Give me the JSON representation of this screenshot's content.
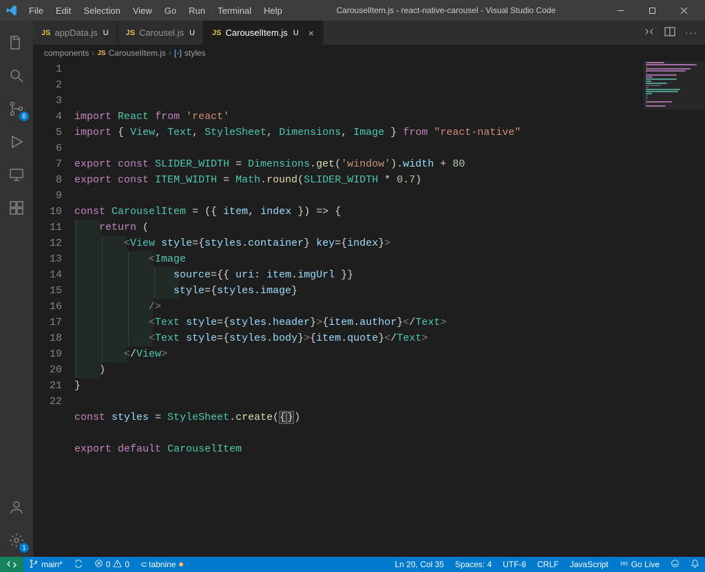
{
  "window": {
    "title": "CarouselItem.js - react-native-carousel - Visual Studio Code"
  },
  "menubar": [
    "File",
    "Edit",
    "Selection",
    "View",
    "Go",
    "Run",
    "Terminal",
    "Help"
  ],
  "activitybar": {
    "explorer_badge": "",
    "scm_badge": "6",
    "settings_badge": "1"
  },
  "tabs": [
    {
      "label": "appData.js",
      "modified": "U",
      "active": false
    },
    {
      "label": "Carousel.js",
      "modified": "U",
      "active": false
    },
    {
      "label": "CarouselItem.js",
      "modified": "U",
      "active": true
    }
  ],
  "breadcrumb": {
    "folder": "components",
    "file": "CarouselItem.js",
    "symbol": "styles"
  },
  "code": {
    "lines": [
      "import React from 'react'",
      "import { View, Text, StyleSheet, Dimensions, Image } from \"react-native\"",
      "",
      "export const SLIDER_WIDTH = Dimensions.get('window').width + 80",
      "export const ITEM_WIDTH = Math.round(SLIDER_WIDTH * 0.7)",
      "",
      "const CarouselItem = ({ item, index }) => {",
      "    return (",
      "        <View style={styles.container} key={index}>",
      "            <Image",
      "                source={{ uri: item.imgUrl }}",
      "                style={styles.image}",
      "            />",
      "            <Text style={styles.header}>{item.author}</Text>",
      "            <Text style={styles.body}>{item.quote}</Text>",
      "        </View>",
      "    )",
      "}",
      "",
      "const styles = StyleSheet.create({})",
      "",
      "export default CarouselItem"
    ],
    "cursor_line": 20,
    "cursor_col": 35
  },
  "statusbar": {
    "branch": "main*",
    "sync": "",
    "errors": "0",
    "warnings": "0",
    "tabnine": "tabnine",
    "ln_col": "Ln 20, Col 35",
    "spaces": "Spaces: 4",
    "encoding": "UTF-8",
    "eol": "CRLF",
    "language": "JavaScript",
    "golive": "Go Live"
  }
}
